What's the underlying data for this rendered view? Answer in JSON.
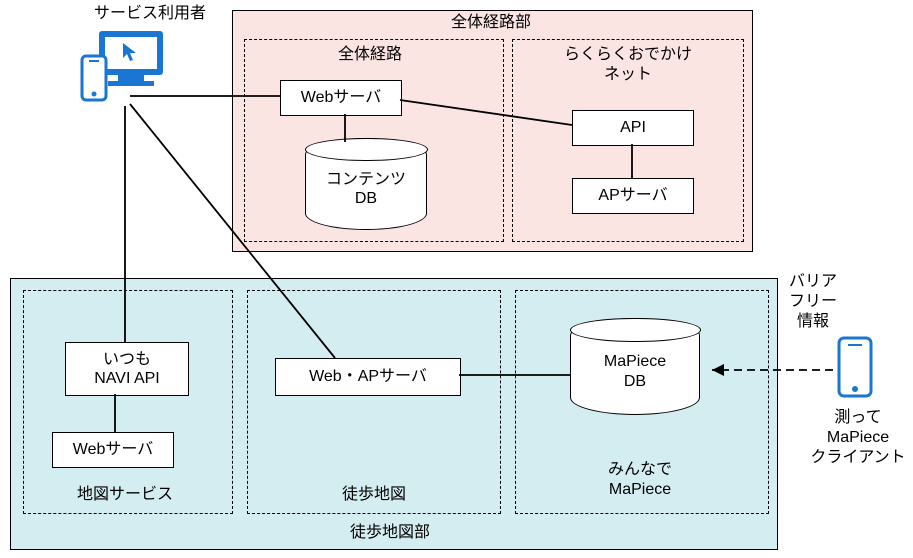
{
  "user": {
    "title": "サービス利用者"
  },
  "zentai": {
    "section_title": "全体経路部",
    "route": {
      "title": "全体経路",
      "web_server": "Webサーバ",
      "db": "コンテンツ\nDB"
    },
    "rakuraku": {
      "title": "らくらくおでかけ\nネット",
      "api": "API",
      "ap_server": "APサーバ"
    }
  },
  "toho": {
    "section_title": "徒歩地図部",
    "map_service": {
      "title": "地図サービス",
      "navi_api": "いつも\nNAVI API",
      "web_server": "Webサーバ"
    },
    "walk_map": {
      "title": "徒歩地図",
      "web_ap_server": "Web・APサーバ"
    },
    "mapiece": {
      "title": "みんなで\nMaPiece",
      "db": "MaPiece\nDB"
    }
  },
  "barrier_free": {
    "label": "バリア\nフリー\n情報",
    "client": "測って\nMaPiece\nクライアント"
  }
}
